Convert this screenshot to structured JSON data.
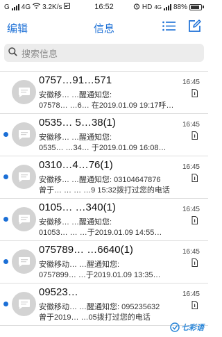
{
  "status_bar": {
    "carrier": "G",
    "network": "4G",
    "speed": "3.2K/s",
    "time": "16:52",
    "hd": "HD",
    "lte": "4G",
    "battery_text": "88%",
    "battery_level": 0.88
  },
  "nav": {
    "edit_label": "编辑",
    "title": "信息"
  },
  "search": {
    "placeholder": "搜索信息"
  },
  "messages": [
    {
      "title": "0757…91…571",
      "line1": "安徽移…      …醒通知您:",
      "line2": "07578…   …6… 在2019.01.09 19:17呼…",
      "time": "16:45",
      "unread": false
    },
    {
      "title": "0535… 5…38(1)",
      "line1": "安徽移…      …醒通知您:",
      "line2": "0535…   …34…  于2019.01.09 16:08…",
      "time": "16:45",
      "unread": true
    },
    {
      "title": "0310…4…76(1)",
      "line1": "安徽移…      …醒通知您: 03104647876",
      "line2": "曾于…  …  …  …9 15:32拨打过您的电话",
      "time": "16:45",
      "unread": true
    },
    {
      "title": "0105…    …340(1)",
      "line1": "安徽移…      …醒通知您:",
      "line2": "01053…  …  …于2019.01.09 14:55…",
      "time": "16:45",
      "unread": true
    },
    {
      "title": "075789…  …6640(1)",
      "line1": "安徽移动…   …醒通知您:",
      "line2": "0757899…  …于2019.01.09 13:35…",
      "time": "16:45",
      "unread": true
    },
    {
      "title": "09523…",
      "line1": "安徽移动…      …醒通知您: 095235632",
      "line2": "曾于2019…  …05拨打过您的电话",
      "time": "16:45",
      "unread": true
    }
  ],
  "watermark": {
    "text": "七彩语"
  },
  "colors": {
    "accent": "#1b6fd6",
    "unread_dot": "#1b6fd6",
    "avatar_bg": "#d3d3d3"
  }
}
